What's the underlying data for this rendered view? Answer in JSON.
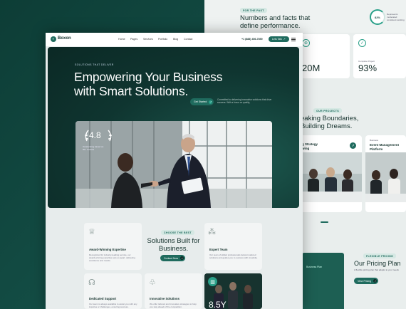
{
  "background_page": {
    "stats": {
      "tag": "FOR THE PAST",
      "headline_line1": "Numbers and facts that",
      "headline_line2": "define performance.",
      "progress_label": "82%",
      "progress_value": 0.82,
      "progress_note": "Represents moderated consistent working"
    },
    "stat_cards": [
      {
        "icon": "globe-icon",
        "value": "20M",
        "label": ""
      },
      {
        "icon": "check-circle-icon",
        "value": "93%",
        "label": "Complete Project"
      }
    ],
    "projects": {
      "tag": "OUR PROJECTS",
      "heading_line1": "eaking Boundaries,",
      "heading_line2": "Building Dreams.",
      "cards": [
        {
          "category": "",
          "title_line1": "g Strategy",
          "title_line2": "wing"
        },
        {
          "category": "Business",
          "title_line1": "Event Management",
          "title_line2": "Platform"
        }
      ]
    },
    "pricing": {
      "tag": "FLEXIBLE PRICING",
      "title": "Our Pricing Plan",
      "description": "A flexible pricing plan that adapts to your needs",
      "button": "View Pricing",
      "dark_panel_text": "Business Plan"
    }
  },
  "foreground_page": {
    "nav": {
      "logo": "Boxon",
      "links": [
        "Home",
        "Pages",
        "Services",
        "Portfolio",
        "Blog",
        "Contact"
      ],
      "phone": "+1 (888) 456-7890",
      "cta": "Lets Talk"
    },
    "hero": {
      "tag": "SOLUTIONS THAT DELIVER",
      "title_line1": "Empowering Your Business",
      "title_line2": "with Smart Solutions.",
      "button": "Get Started",
      "description": "Committed to delivering innovative solutions that drive success. With a focus on quality,",
      "rating": "4.8",
      "rating_text_line1": "Outstanding based on",
      "rating_text_line2": "50+ reviews"
    },
    "features": {
      "tag": "CHOOSE THE BEST",
      "title_line1": "Solutions Built for",
      "title_line2": "Business.",
      "button": "Contact Now",
      "cards": [
        {
          "icon": "trophy-icon",
          "title": "Award-Winning Expertise",
          "desc": "Recognized for industry-leading service, our award-winning expertise sets us apart, delivering excellence and results."
        },
        {
          "icon": "team-icon",
          "title": "Expert Team",
          "desc": "Our team of skilled professionals delivers tailored solutions and guides you to success with creativity."
        },
        {
          "icon": "headset-icon",
          "title": "Dedicated Support",
          "desc": "Our team is always available to assist you with any inquiries or challenges, ensuring success."
        },
        {
          "icon": "bulb-icon",
          "title": "Innovative Solutions",
          "desc": "We offer tailored and innovative strategies to help you stay ahead of the competition."
        }
      ],
      "dark_card_number": "8.5Y"
    }
  },
  "colors": {
    "backdrop": "#124a42",
    "accent": "#1f6b5e",
    "accent_light": "#2aa089",
    "hero_bg": "#0f3530",
    "page_bg": "#e7ecec"
  }
}
